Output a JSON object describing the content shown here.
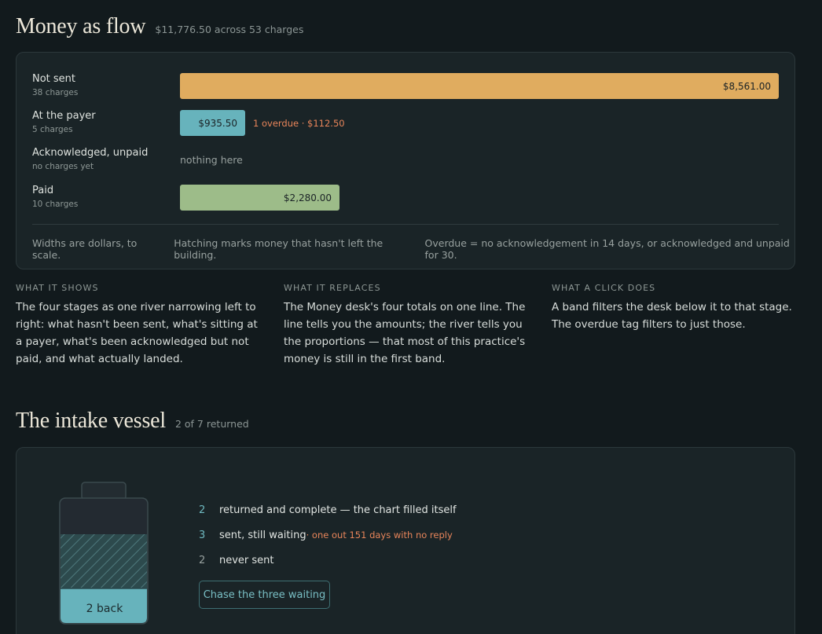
{
  "flow": {
    "title": "Money as flow",
    "subtitle": "$11,776.50 across 53 charges",
    "rows": [
      {
        "name": "Not sent",
        "count": "38 charges",
        "amount": "$8,561.00",
        "value": 8561.0,
        "color": "#e0ac5f"
      },
      {
        "name": "At the payer",
        "count": "5 charges",
        "amount": "$935.50",
        "value": 935.5,
        "color": "#67b3bc",
        "overdue": "1 overdue · $112.50"
      },
      {
        "name": "Acknowledged, unpaid",
        "count": "no charges yet",
        "amount": "",
        "value": 0,
        "empty_text": "nothing here"
      },
      {
        "name": "Paid",
        "count": "10 charges",
        "amount": "$2,280.00",
        "value": 2280.0,
        "color": "#9dbc89"
      }
    ],
    "notes": [
      "Widths are dollars, to scale.",
      "Hatching marks money that hasn't left the building.",
      "Overdue = no acknowledgement in 14 days, or acknowledged and unpaid for 30."
    ]
  },
  "explainer": [
    {
      "title": "What it shows",
      "text": "The four stages as one river narrowing left to right: what hasn't been sent, what's sitting at a payer, what's been acknowledged but not paid, and what actually landed."
    },
    {
      "title": "What it replaces",
      "text": "The Money desk's four totals on one line. The line tells you the amounts; the river tells you the proportions — that most of this practice's money is still in the first band."
    },
    {
      "title": "What a click does",
      "text": "A band filters the desk below it to that stage. The overdue tag filters to just those."
    }
  ],
  "intake": {
    "title": "The intake vessel",
    "subtitle": "2 of 7 returned",
    "vessel_label": "2 back",
    "returned": 2,
    "waiting": 3,
    "never_sent": 2,
    "total": 7,
    "items": [
      {
        "num": "2",
        "label": "returned and complete — the chart filled itself",
        "note": "",
        "num_color": "#6fb9c0"
      },
      {
        "num": "3",
        "label": "sent, still waiting",
        "note": " · one out 151 days with no reply",
        "num_color": "#6fb9c0"
      },
      {
        "num": "2",
        "label": "never sent",
        "note": "",
        "num_color": "#98a19f"
      }
    ],
    "button": "Chase the three waiting"
  }
}
